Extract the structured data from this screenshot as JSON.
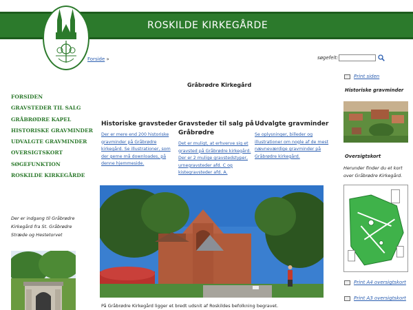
{
  "header": {
    "title": "ROSKILDE KIRKEGÅRDE"
  },
  "breadcrumb": {
    "link": "Forside",
    "sep": "»"
  },
  "search": {
    "label": "søgefelt:",
    "value": ""
  },
  "nav": [
    {
      "label": "FORSIDEN"
    },
    {
      "label": "GRAVSTEDER TIL SALG"
    },
    {
      "label": "GRÅBRØDRE KAPEL"
    },
    {
      "label": "HISTORISKE GRAVMINDER"
    },
    {
      "label": "UDVALGTE GRAVMINDER"
    },
    {
      "label": "OVERSIGTSKORT"
    },
    {
      "label": "SØGEFUNKTION"
    },
    {
      "label": "ROSKILDE KIRKEGÅRDE"
    }
  ],
  "side_note": "Der er indgang til Gråbrødre Kirkegård fra St. Gråbrødre Stræde og Hestetorvet",
  "main": {
    "title": "Gråbrødre Kirkegård",
    "columns": [
      {
        "heading": "Historiske gravsteder",
        "text": "Der er mere end 200 historiske gravminder på Gråbrødre kirkegård. Se illustrationer, som der gerne må downloades, på denne hjemmeside."
      },
      {
        "heading": "Gravsteder til salg på Gråbrødre",
        "text": "Det er muligt, at erhverve sig et gravsted på Gråbrødre kirkegård. Der er 2 mulige gravstedstyper, urnegravsteder afd. C og kistegravsteder afd. A."
      },
      {
        "heading": "Udvalgte gravminder",
        "text": "Se oplysninger, billeder og illustrationer om nogle af de mest nævneværdige gravminder på Gråbrødre kirkegård."
      }
    ],
    "caption": "På Gråbrødre Kirkegård ligger et bredt udsnit af Roskildes befolkning begravet."
  },
  "right": {
    "print_page": "Print siden",
    "heading_history": "Historiske gravminder",
    "heading_map": "Oversigtskort",
    "map_text": "Herunder finder du et kort over Gråbrødre Kirkegård.",
    "print_a4": "Print A4 oversigtskort",
    "print_a3": "Print A3 oversigtskort"
  }
}
